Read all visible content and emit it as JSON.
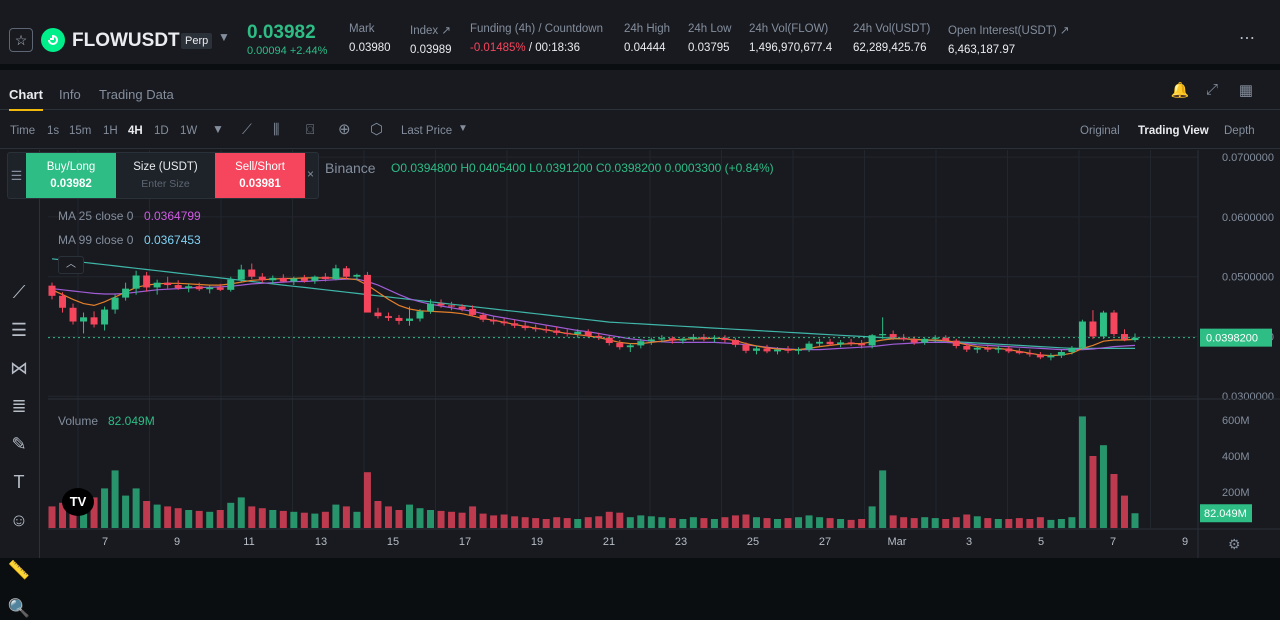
{
  "header": {
    "symbol": "FLOWUSDT",
    "contract_type": "Perp",
    "last_price": "0.03982",
    "price_change": "0.00094 +2.44%",
    "stats": [
      {
        "label": "Mark",
        "value": "0.03980"
      },
      {
        "label": "Index ↗",
        "value": "0.03989"
      },
      {
        "label": "Funding (4h) / Countdown",
        "value_red": "-0.01485%",
        "value": " / 00:18:36"
      },
      {
        "label": "24h High",
        "value": "0.04444"
      },
      {
        "label": "24h Low",
        "value": "0.03795"
      },
      {
        "label": "24h Vol(FLOW)",
        "value": "1,496,970,677.4"
      },
      {
        "label": "24h Vol(USDT)",
        "value": "62,289,425.76"
      },
      {
        "label": "Open Interest(USDT) ↗",
        "value": "6,463,187.97"
      }
    ]
  },
  "tabs": [
    "Chart",
    "Info",
    "Trading Data"
  ],
  "toolbar": {
    "time_label": "Time",
    "intervals": [
      "1s",
      "15m",
      "1H",
      "4H",
      "1D",
      "1W"
    ],
    "active_interval": "4H",
    "price_type": "Last Price",
    "views": [
      "Original",
      "Trading View",
      "Depth"
    ],
    "active_view": "Trading View"
  },
  "order_panel": {
    "buy_label": "Buy/Long",
    "buy_price": "0.03982",
    "size_label": "Size (USDT)",
    "size_placeholder": "Enter Size",
    "sell_label": "Sell/Short",
    "sell_price": "0.03981"
  },
  "legend": {
    "exchange": "Binance",
    "ohlc": "O0.0394800  H0.0405400  L0.0391200  C0.0398200  0.0003300 (+0.84%)",
    "ma25_label": "MA 25 close 0",
    "ma25_value": "0.0364799",
    "ma99_label": "MA 99 close 0",
    "ma99_value": "0.0367453",
    "volume_label": "Volume",
    "volume_value": "82.049M"
  },
  "colors": {
    "up": "#2ebd85",
    "down": "#f6465d",
    "ma25": "#e47f2a",
    "ma99": "#a05cd6",
    "ma_long": "#3fb6a8",
    "accent": "#f0b90b"
  },
  "chart_data": {
    "type": "candlestick",
    "price_axis_ticks": [
      "0.0700000",
      "0.0600000",
      "0.0500000",
      "0.0400000",
      "0.0300000"
    ],
    "last_price_tag": "0.0398200",
    "volume_axis_ticks": [
      "600M",
      "400M",
      "200M"
    ],
    "volume_last_tag": "82.049M",
    "x_ticks": [
      "7",
      "9",
      "11",
      "13",
      "15",
      "17",
      "19",
      "21",
      "23",
      "25",
      "27",
      "Mar",
      "3",
      "5",
      "7",
      "9"
    ],
    "ylim": [
      0.0297,
      0.0712
    ],
    "vol_max": 700,
    "candles_ohlc": [
      [
        0.0485,
        0.049,
        0.0462,
        0.0468
      ],
      [
        0.0468,
        0.0474,
        0.044,
        0.0448
      ],
      [
        0.0448,
        0.0455,
        0.042,
        0.0425
      ],
      [
        0.0425,
        0.044,
        0.0405,
        0.0432
      ],
      [
        0.0432,
        0.0442,
        0.0415,
        0.042
      ],
      [
        0.042,
        0.045,
        0.041,
        0.0445
      ],
      [
        0.0445,
        0.047,
        0.0438,
        0.0465
      ],
      [
        0.0465,
        0.049,
        0.046,
        0.048
      ],
      [
        0.048,
        0.051,
        0.047,
        0.0502
      ],
      [
        0.0502,
        0.0508,
        0.0475,
        0.0482
      ],
      [
        0.0482,
        0.0495,
        0.047,
        0.049
      ],
      [
        0.049,
        0.05,
        0.048,
        0.0486
      ],
      [
        0.0486,
        0.0494,
        0.0478,
        0.0481
      ],
      [
        0.0481,
        0.0488,
        0.0474,
        0.0484
      ],
      [
        0.0484,
        0.049,
        0.0476,
        0.0479
      ],
      [
        0.0479,
        0.0486,
        0.0472,
        0.0482
      ],
      [
        0.0482,
        0.0488,
        0.0476,
        0.0478
      ],
      [
        0.0478,
        0.05,
        0.0475,
        0.0495
      ],
      [
        0.0495,
        0.052,
        0.049,
        0.0512
      ],
      [
        0.0512,
        0.0522,
        0.0496,
        0.05
      ],
      [
        0.05,
        0.0506,
        0.049,
        0.0494
      ],
      [
        0.0494,
        0.0502,
        0.0488,
        0.0498
      ],
      [
        0.0498,
        0.0504,
        0.049,
        0.0492
      ],
      [
        0.0492,
        0.05,
        0.0486,
        0.0497
      ],
      [
        0.0497,
        0.0503,
        0.049,
        0.0493
      ],
      [
        0.0493,
        0.0502,
        0.0488,
        0.05
      ],
      [
        0.05,
        0.0506,
        0.0492,
        0.0496
      ],
      [
        0.0496,
        0.052,
        0.0494,
        0.0514
      ],
      [
        0.0514,
        0.0518,
        0.0496,
        0.05
      ],
      [
        0.05,
        0.0505,
        0.0494,
        0.0503
      ],
      [
        0.0503,
        0.0508,
        0.047,
        0.044
      ],
      [
        0.044,
        0.0448,
        0.043,
        0.0434
      ],
      [
        0.0434,
        0.044,
        0.0426,
        0.0431
      ],
      [
        0.0431,
        0.0436,
        0.042,
        0.0426
      ],
      [
        0.0426,
        0.045,
        0.0418,
        0.043
      ],
      [
        0.043,
        0.0446,
        0.0425,
        0.0442
      ],
      [
        0.0442,
        0.0462,
        0.0438,
        0.0455
      ],
      [
        0.0455,
        0.0462,
        0.0448,
        0.0452
      ],
      [
        0.0452,
        0.0458,
        0.0444,
        0.045
      ],
      [
        0.045,
        0.0454,
        0.0442,
        0.0446
      ],
      [
        0.0446,
        0.0452,
        0.0434,
        0.0436
      ],
      [
        0.0436,
        0.044,
        0.0424,
        0.0428
      ],
      [
        0.0428,
        0.0434,
        0.042,
        0.0425
      ],
      [
        0.0425,
        0.043,
        0.0418,
        0.0422
      ],
      [
        0.0422,
        0.0428,
        0.0414,
        0.0418
      ],
      [
        0.0418,
        0.0424,
        0.041,
        0.0414
      ],
      [
        0.0414,
        0.042,
        0.0408,
        0.0412
      ],
      [
        0.0412,
        0.0418,
        0.0406,
        0.041
      ],
      [
        0.041,
        0.0416,
        0.0402,
        0.0406
      ],
      [
        0.0406,
        0.0412,
        0.04,
        0.0404
      ],
      [
        0.0404,
        0.0412,
        0.0398,
        0.0408
      ],
      [
        0.0408,
        0.0412,
        0.0398,
        0.0401
      ],
      [
        0.0401,
        0.0406,
        0.0394,
        0.0398
      ],
      [
        0.0398,
        0.0402,
        0.0385,
        0.0389
      ],
      [
        0.0389,
        0.0394,
        0.0378,
        0.0382
      ],
      [
        0.0382,
        0.0388,
        0.0374,
        0.0385
      ],
      [
        0.0385,
        0.0396,
        0.038,
        0.0392
      ],
      [
        0.0392,
        0.0398,
        0.0386,
        0.0395
      ],
      [
        0.0395,
        0.0402,
        0.039,
        0.0397
      ],
      [
        0.0397,
        0.04,
        0.0388,
        0.0393
      ],
      [
        0.0393,
        0.0398,
        0.0388,
        0.0396
      ],
      [
        0.0396,
        0.0404,
        0.0392,
        0.0399
      ],
      [
        0.0399,
        0.0404,
        0.0392,
        0.0396
      ],
      [
        0.0396,
        0.0402,
        0.039,
        0.0398
      ],
      [
        0.0398,
        0.0402,
        0.039,
        0.0394
      ],
      [
        0.0394,
        0.0398,
        0.0382,
        0.0386
      ],
      [
        0.0386,
        0.039,
        0.0372,
        0.0376
      ],
      [
        0.0376,
        0.0384,
        0.037,
        0.038
      ],
      [
        0.038,
        0.0386,
        0.0372,
        0.0375
      ],
      [
        0.0375,
        0.0382,
        0.037,
        0.0378
      ],
      [
        0.0378,
        0.0384,
        0.0372,
        0.0376
      ],
      [
        0.0376,
        0.0382,
        0.037,
        0.0378
      ],
      [
        0.0378,
        0.0392,
        0.0374,
        0.0388
      ],
      [
        0.0388,
        0.0396,
        0.0382,
        0.0391
      ],
      [
        0.0391,
        0.0396,
        0.0384,
        0.0387
      ],
      [
        0.0387,
        0.0394,
        0.0382,
        0.039
      ],
      [
        0.039,
        0.0396,
        0.0384,
        0.0388
      ],
      [
        0.0388,
        0.0394,
        0.038,
        0.0385
      ],
      [
        0.0385,
        0.0404,
        0.038,
        0.0402
      ],
      [
        0.0402,
        0.0432,
        0.0396,
        0.0404
      ],
      [
        0.0404,
        0.041,
        0.0394,
        0.0398
      ],
      [
        0.0398,
        0.0404,
        0.0392,
        0.0395
      ],
      [
        0.0395,
        0.04,
        0.0386,
        0.039
      ],
      [
        0.039,
        0.0398,
        0.0386,
        0.0396
      ],
      [
        0.0396,
        0.0402,
        0.039,
        0.0398
      ],
      [
        0.0398,
        0.0402,
        0.039,
        0.0393
      ],
      [
        0.0393,
        0.0396,
        0.038,
        0.0384
      ],
      [
        0.0384,
        0.0388,
        0.0374,
        0.0378
      ],
      [
        0.0378,
        0.0384,
        0.0372,
        0.0381
      ],
      [
        0.0381,
        0.0386,
        0.0374,
        0.0378
      ],
      [
        0.0378,
        0.0384,
        0.0372,
        0.038
      ],
      [
        0.038,
        0.0384,
        0.0372,
        0.0375
      ],
      [
        0.0375,
        0.038,
        0.037,
        0.0372
      ],
      [
        0.0372,
        0.0378,
        0.0366,
        0.037
      ],
      [
        0.037,
        0.0374,
        0.0362,
        0.0365
      ],
      [
        0.0365,
        0.0372,
        0.036,
        0.0368
      ],
      [
        0.0368,
        0.0378,
        0.0364,
        0.0374
      ],
      [
        0.0374,
        0.0384,
        0.037,
        0.0381
      ],
      [
        0.0381,
        0.0428,
        0.0378,
        0.0425
      ],
      [
        0.0425,
        0.0444,
        0.0396,
        0.04
      ],
      [
        0.04,
        0.0443,
        0.0396,
        0.044
      ],
      [
        0.044,
        0.0444,
        0.04,
        0.0404
      ],
      [
        0.0404,
        0.0412,
        0.0392,
        0.0395
      ],
      [
        0.0394,
        0.0405,
        0.0391,
        0.0398
      ]
    ],
    "volumes": [
      120,
      140,
      180,
      160,
      170,
      220,
      320,
      180,
      220,
      150,
      130,
      120,
      110,
      100,
      95,
      90,
      100,
      140,
      170,
      120,
      110,
      100,
      95,
      90,
      85,
      80,
      90,
      130,
      120,
      90,
      310,
      150,
      120,
      100,
      130,
      110,
      100,
      95,
      90,
      85,
      120,
      80,
      70,
      75,
      65,
      60,
      55,
      50,
      60,
      55,
      50,
      60,
      65,
      90,
      85,
      60,
      70,
      65,
      60,
      55,
      50,
      60,
      55,
      50,
      60,
      70,
      75,
      60,
      55,
      50,
      55,
      60,
      70,
      60,
      55,
      50,
      45,
      50,
      120,
      320,
      70,
      60,
      55,
      60,
      55,
      50,
      60,
      75,
      65,
      55,
      50,
      50,
      55,
      50,
      60,
      45,
      50,
      60,
      620,
      400,
      460,
      300,
      180,
      82
    ],
    "ma25": [
      0.0478,
      0.047,
      0.0462,
      0.0455,
      0.0452,
      0.0458,
      0.0466,
      0.0474,
      0.0482,
      0.0486,
      0.0488,
      0.0489,
      0.0489,
      0.0488,
      0.0487,
      0.0486,
      0.0486,
      0.0488,
      0.0491,
      0.0494,
      0.0495,
      0.0496,
      0.0497,
      0.0497,
      0.0498,
      0.0498,
      0.0498,
      0.0498,
      0.0497,
      0.0495,
      0.0486,
      0.0474,
      0.0462,
      0.0452,
      0.0446,
      0.0443,
      0.0442,
      0.0441,
      0.044,
      0.0438,
      0.0434,
      0.043,
      0.0427,
      0.0424,
      0.042,
      0.0417,
      0.0414,
      0.0411,
      0.0408,
      0.0405,
      0.0403,
      0.0401,
      0.0398,
      0.0394,
      0.039,
      0.0388,
      0.0388,
      0.039,
      0.0392,
      0.0394,
      0.0395,
      0.0396,
      0.0396,
      0.0397,
      0.0396,
      0.0393,
      0.0388,
      0.0384,
      0.0381,
      0.0379,
      0.0378,
      0.0378,
      0.038,
      0.0383,
      0.0385,
      0.0387,
      0.0388,
      0.0388,
      0.0391,
      0.0394,
      0.0396,
      0.0396,
      0.0395,
      0.0394,
      0.0394,
      0.0393,
      0.039,
      0.0386,
      0.0383,
      0.0381,
      0.038,
      0.0378,
      0.0375,
      0.0372,
      0.0369,
      0.0368,
      0.0369,
      0.0372,
      0.038,
      0.0385,
      0.0392,
      0.0394,
      0.0394,
      0.0395
    ],
    "ma99": [
      0.048,
      0.0478,
      0.0476,
      0.0474,
      0.0472,
      0.0471,
      0.0471,
      0.0472,
      0.0474,
      0.0476,
      0.0478,
      0.0479,
      0.048,
      0.0481,
      0.0482,
      0.0482,
      0.0483,
      0.0484,
      0.0486,
      0.0488,
      0.0489,
      0.049,
      0.0491,
      0.0492,
      0.0492,
      0.0493,
      0.0494,
      0.0495,
      0.0496,
      0.0496,
      0.0492,
      0.0486,
      0.0478,
      0.047,
      0.0463,
      0.0458,
      0.0454,
      0.0451,
      0.0448,
      0.0445,
      0.0442,
      0.0438,
      0.0434,
      0.0431,
      0.0428,
      0.0425,
      0.0422,
      0.0419,
      0.0416,
      0.0413,
      0.041,
      0.0408,
      0.0405,
      0.0402,
      0.0399,
      0.0396,
      0.0394,
      0.0392,
      0.0391,
      0.039,
      0.039,
      0.039,
      0.039,
      0.039,
      0.0389,
      0.0388,
      0.0386,
      0.0384,
      0.0382,
      0.038,
      0.0379,
      0.0378,
      0.0378,
      0.0378,
      0.0379,
      0.038,
      0.0381,
      0.0382,
      0.0383,
      0.0385,
      0.0387,
      0.0388,
      0.0389,
      0.039,
      0.039,
      0.039,
      0.0389,
      0.0388,
      0.0386,
      0.0385,
      0.0384,
      0.0383,
      0.0382,
      0.0381,
      0.038,
      0.0379,
      0.0378,
      0.0378,
      0.0378,
      0.0379,
      0.0381,
      0.0383,
      0.0384,
      0.0385
    ],
    "ma_long": [
      0.053,
      0.0528,
      0.0526,
      0.0524,
      0.0522,
      0.052,
      0.0518,
      0.0516,
      0.0514,
      0.0512,
      0.051,
      0.0508,
      0.0506,
      0.0504,
      0.0502,
      0.05,
      0.0498,
      0.0496,
      0.0494,
      0.0492,
      0.049,
      0.0488,
      0.0486,
      0.0484,
      0.0482,
      0.048,
      0.0478,
      0.0476,
      0.0474,
      0.0472,
      0.047,
      0.0468,
      0.0466,
      0.0464,
      0.0462,
      0.046,
      0.0458,
      0.0456,
      0.0454,
      0.0452,
      0.045,
      0.0448,
      0.0446,
      0.0444,
      0.0442,
      0.044,
      0.0438,
      0.0436,
      0.0434,
      0.0432,
      0.043,
      0.0428,
      0.0426,
      0.0424,
      0.0423,
      0.0422,
      0.0421,
      0.042,
      0.0419,
      0.0418,
      0.0417,
      0.0416,
      0.0415,
      0.0414,
      0.0413,
      0.0412,
      0.0411,
      0.041,
      0.0409,
      0.0408,
      0.0407,
      0.0406,
      0.0405,
      0.0404,
      0.0403,
      0.0402,
      0.0401,
      0.04,
      0.0399,
      0.0398,
      0.0397,
      0.0396,
      0.0395,
      0.0394,
      0.0393,
      0.0392,
      0.0391,
      0.039,
      0.0389,
      0.0388,
      0.0387,
      0.0386,
      0.0385,
      0.0384,
      0.0383,
      0.0382,
      0.0381,
      0.038,
      0.038,
      0.038,
      0.038,
      0.038,
      0.038,
      0.038
    ]
  }
}
